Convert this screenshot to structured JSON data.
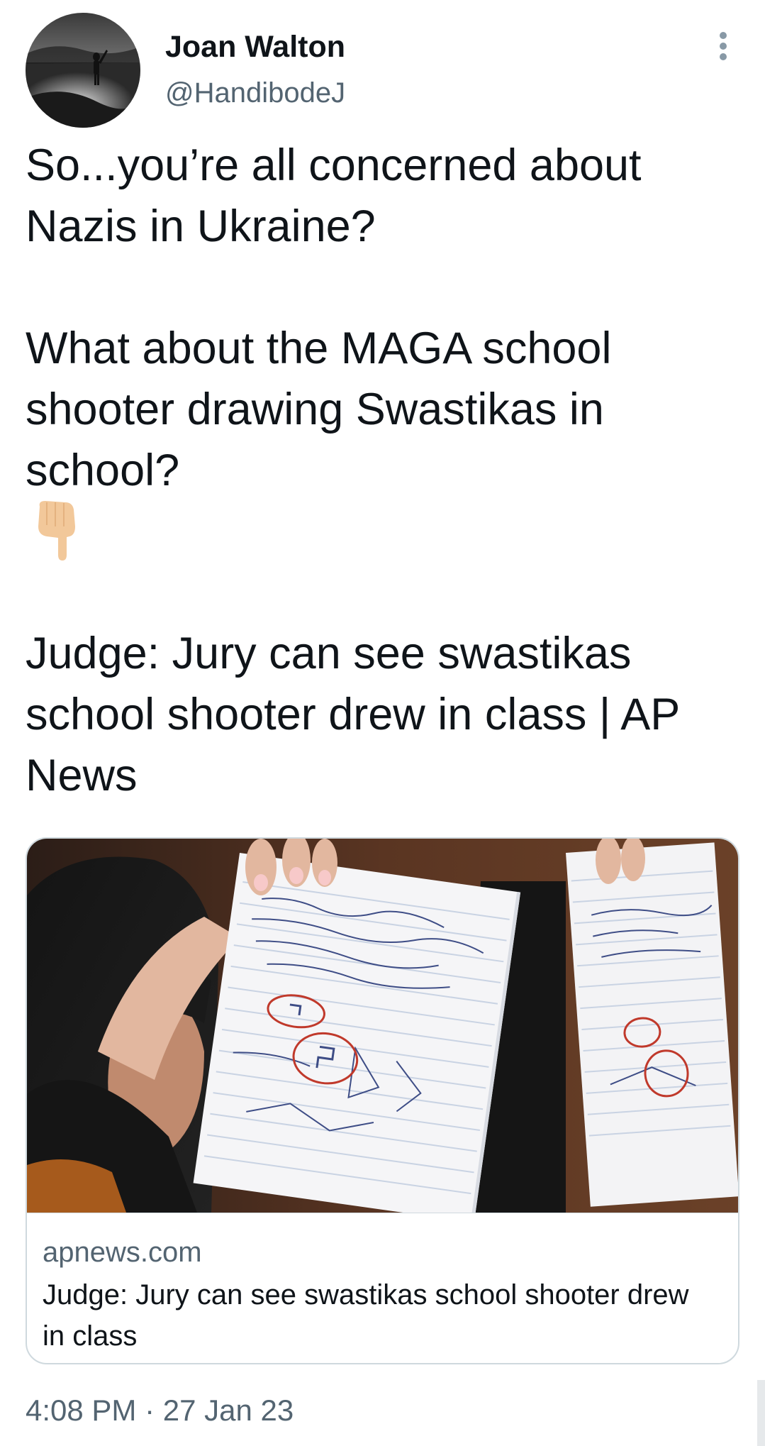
{
  "author": {
    "display_name": "Joan Walton",
    "handle": "@HandibodeJ"
  },
  "tweet": {
    "paragraph_1": "So...you’re all concerned about\nNazis in Ukraine?",
    "paragraph_2": "What about the MAGA school shooter drawing Swastikas in school?",
    "emoji": "point-down-icon",
    "paragraph_3": "Judge: Jury can see swastikas school shooter drew in class | AP News"
  },
  "link_card": {
    "domain": "apnews.com",
    "title": "Judge: Jury can see swastikas school shooter drew in class"
  },
  "meta": {
    "time": "4:08 PM",
    "separator": " · ",
    "date": "27 Jan 23"
  },
  "colors": {
    "text_primary": "#0f1419",
    "text_secondary": "#536471",
    "border": "#cfd9de",
    "more_dots": "#8899a6",
    "emoji_skin": "#f2c89a"
  }
}
